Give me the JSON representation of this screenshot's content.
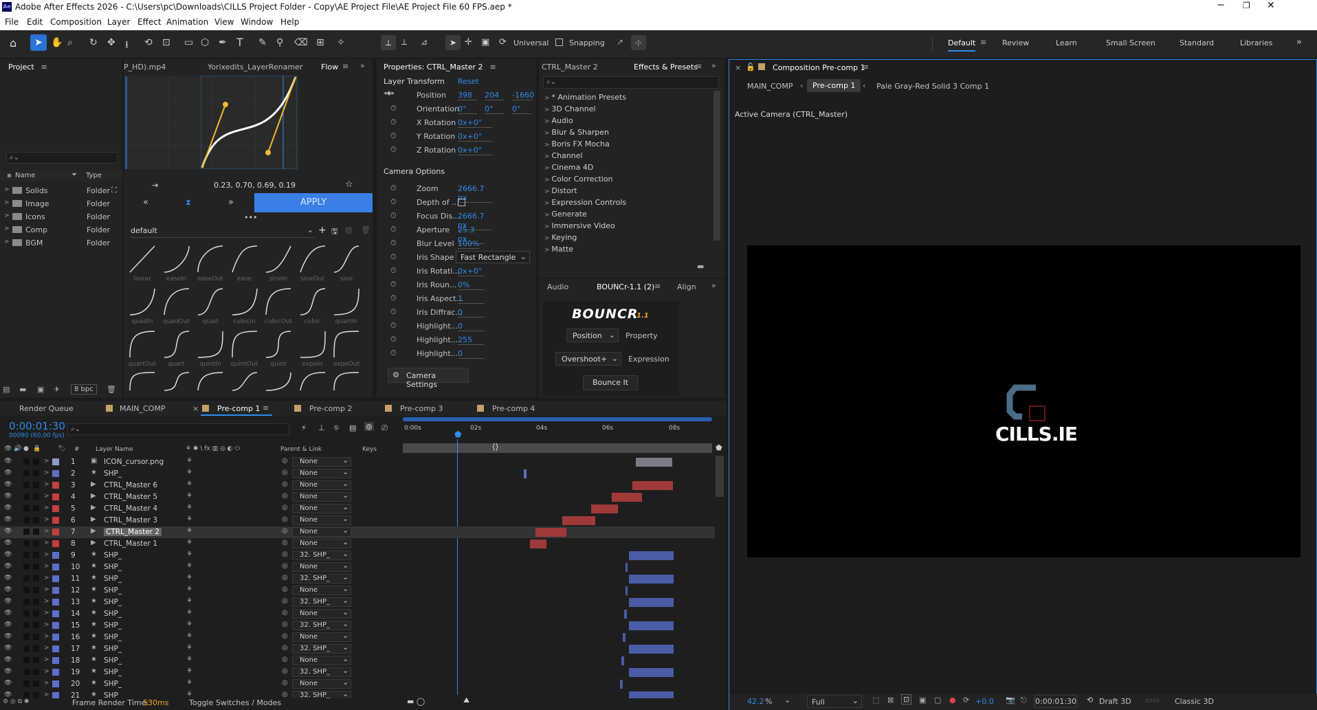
{
  "app": {
    "title": "Adobe After Effects 2026 - C:\\Users\\pc\\Downloads\\CILLS Project Folder - Copy\\AE Project File\\AE Project File 60 FPS.aep *",
    "logo": "Ae"
  },
  "menu": [
    "File",
    "Edit",
    "Composition",
    "Layer",
    "Effect",
    "Animation",
    "View",
    "Window",
    "Help"
  ],
  "toolbar": {
    "universal": "Universal",
    "snapping": "Snapping",
    "workspaces": [
      "Default",
      "Review",
      "Learn",
      "Small Screen",
      "Standard",
      "Libraries"
    ]
  },
  "project": {
    "title": "Project",
    "col_name": "Name",
    "col_type": "Type",
    "items": [
      {
        "name": "Solids",
        "type": "Folder"
      },
      {
        "name": "Image",
        "type": "Folder"
      },
      {
        "name": "Icons",
        "type": "Folder"
      },
      {
        "name": "Comp",
        "type": "Folder"
      },
      {
        "name": "BGM",
        "type": "Folder"
      }
    ],
    "bpc": "8 bpc"
  },
  "flow": {
    "tabs": [
      "P_HD).mp4",
      "Yorixedits_LayerRenamer",
      "Flow"
    ],
    "values": "0.23, 0.70, 0.69, 0.19",
    "apply": "APPLY",
    "preset": "default",
    "curves": [
      [
        "linear",
        "easeIn",
        "easeOut",
        "ease",
        "sineIn",
        "sineOut",
        "sine"
      ],
      [
        "quadIn",
        "quadOut",
        "quad",
        "cubicIn",
        "cubicOut",
        "cubic",
        "quartIn"
      ],
      [
        "quartOut",
        "quart",
        "quintIn",
        "quintOut",
        "quint",
        "expoIn",
        "expoOut"
      ]
    ]
  },
  "properties": {
    "title": "Properties: CTRL_Master 2",
    "layer_transform": "Layer Transform",
    "reset": "Reset",
    "rows": [
      {
        "name": "Position",
        "values": [
          "398",
          "204",
          "-1660"
        ]
      },
      {
        "name": "Orientation",
        "values": [
          "0°",
          "0°",
          "0°"
        ]
      },
      {
        "name": "X Rotation",
        "values": [
          "0x+0°"
        ]
      },
      {
        "name": "Y Rotation",
        "values": [
          "0x+0°"
        ]
      },
      {
        "name": "Z Rotation",
        "values": [
          "0x+0°"
        ]
      }
    ],
    "camera_options": "Camera Options",
    "camera_rows": [
      {
        "name": "Zoom",
        "value": "2666.7 px"
      },
      {
        "name": "Depth of ...",
        "value": ""
      },
      {
        "name": "Focus Dis...",
        "value": "2666.7 px"
      },
      {
        "name": "Aperture",
        "value": "25.3 px"
      },
      {
        "name": "Blur Level",
        "value": "100%"
      },
      {
        "name": "Iris Shape",
        "value": "Fast Rectangle"
      },
      {
        "name": "Iris Rotati...",
        "value": "0x+0°"
      },
      {
        "name": "Iris Roun...",
        "value": "0%"
      },
      {
        "name": "Iris Aspect...",
        "value": "1"
      },
      {
        "name": "Iris Diffrac...",
        "value": "0"
      },
      {
        "name": "Highlight...",
        "value": "0"
      },
      {
        "name": "Highlight...",
        "value": "255"
      },
      {
        "name": "Highlight...",
        "value": "0"
      }
    ],
    "camera_settings": "Camera Settings"
  },
  "effects": {
    "tabs": [
      "CTRL_Master 2",
      "Effects & Presets"
    ],
    "items": [
      "* Animation Presets",
      "3D Channel",
      "Audio",
      "Blur & Sharpen",
      "Boris FX Mocha",
      "Channel",
      "Cinema 4D",
      "Color Correction",
      "Distort",
      "Expression Controls",
      "Generate",
      "Immersive Video",
      "Keying",
      "Matte"
    ]
  },
  "bouncr": {
    "tabs": [
      "Audio",
      "BOUNCr-1.1 (2)",
      "Align"
    ],
    "logo": "BOUNCR",
    "version": "1.1",
    "property_select": "Position",
    "property_label": "Property",
    "expression_select": "Overshoot+",
    "expression_label": "Expression",
    "button": "Bounce It"
  },
  "viewer": {
    "title": "Composition Pre-comp 1",
    "crumbs": [
      "MAIN_COMP",
      "Pre-comp 1",
      "Pale Gray-Red Solid 3 Comp 1"
    ],
    "camera": "Active Camera (CTRL_Master)",
    "logo_text": "CILLS.IE",
    "zoom": "42.2",
    "zoom_unit": "%",
    "res": "Full",
    "exposure": "+0.0",
    "timecode": "0:00:01:30",
    "renderer": "Draft 3D",
    "view": "Classic 3D"
  },
  "timeline": {
    "tabs": [
      "Render Queue",
      "MAIN_COMP",
      "Pre-comp 1",
      "Pre-comp 2",
      "Pre-comp 3",
      "Pre-comp 4"
    ],
    "timecode": "0:00:01:30",
    "frames": "00090 (60.00 fps)",
    "col_num": "#",
    "col_layer": "Layer Name",
    "col_parent": "Parent & Link",
    "col_keys": "Keys",
    "ruler": [
      "0:00s",
      "02s",
      "04s",
      "06s",
      "08s"
    ],
    "layers": [
      {
        "n": "1",
        "name": "ICON_cursor.png",
        "parent": "None",
        "color": "#8e9ec9",
        "type": "img"
      },
      {
        "n": "2",
        "name": "SHP_",
        "parent": "None",
        "color": "#5d6fc9",
        "type": "star"
      },
      {
        "n": "3",
        "name": "CTRL_Master 6",
        "parent": "None",
        "color": "#c24040",
        "type": "cam"
      },
      {
        "n": "4",
        "name": "CTRL_Master 5",
        "parent": "None",
        "color": "#c24040",
        "type": "cam"
      },
      {
        "n": "5",
        "name": "CTRL_Master 4",
        "parent": "None",
        "color": "#c24040",
        "type": "cam"
      },
      {
        "n": "6",
        "name": "CTRL_Master 3",
        "parent": "None",
        "color": "#c24040",
        "type": "cam"
      },
      {
        "n": "7",
        "name": "CTRL_Master 2",
        "parent": "None",
        "color": "#c24040",
        "type": "cam"
      },
      {
        "n": "8",
        "name": "CTRL_Master 1",
        "parent": "None",
        "color": "#c24040",
        "type": "cam"
      },
      {
        "n": "9",
        "name": "SHP_",
        "parent": "32. SHP_",
        "color": "#5d6fc9",
        "type": "star"
      },
      {
        "n": "10",
        "name": "SHP_",
        "parent": "None",
        "color": "#5d6fc9",
        "type": "star"
      },
      {
        "n": "11",
        "name": "SHP_",
        "parent": "32. SHP_",
        "color": "#5d6fc9",
        "type": "star"
      },
      {
        "n": "12",
        "name": "SHP_",
        "parent": "None",
        "color": "#5d6fc9",
        "type": "star"
      },
      {
        "n": "13",
        "name": "SHP_",
        "parent": "32. SHP_",
        "color": "#5d6fc9",
        "type": "star"
      },
      {
        "n": "14",
        "name": "SHP_",
        "parent": "None",
        "color": "#5d6fc9",
        "type": "star"
      },
      {
        "n": "15",
        "name": "SHP_",
        "parent": "32. SHP_",
        "color": "#5d6fc9",
        "type": "star"
      },
      {
        "n": "16",
        "name": "SHP_",
        "parent": "None",
        "color": "#5d6fc9",
        "type": "star"
      },
      {
        "n": "17",
        "name": "SHP_",
        "parent": "32. SHP_",
        "color": "#5d6fc9",
        "type": "star"
      },
      {
        "n": "18",
        "name": "SHP_",
        "parent": "None",
        "color": "#5d6fc9",
        "type": "star"
      },
      {
        "n": "19",
        "name": "SHP_",
        "parent": "32. SHP_",
        "color": "#5d6fc9",
        "type": "star"
      },
      {
        "n": "20",
        "name": "SHP_",
        "parent": "None",
        "color": "#5d6fc9",
        "type": "star"
      },
      {
        "n": "21",
        "name": "SHP_",
        "parent": "32. SHP_",
        "color": "#5d6fc9",
        "type": "star"
      }
    ],
    "render_time_label": "Frame Render Time:",
    "render_time": "530ms",
    "toggle": "Toggle Switches / Modes"
  }
}
